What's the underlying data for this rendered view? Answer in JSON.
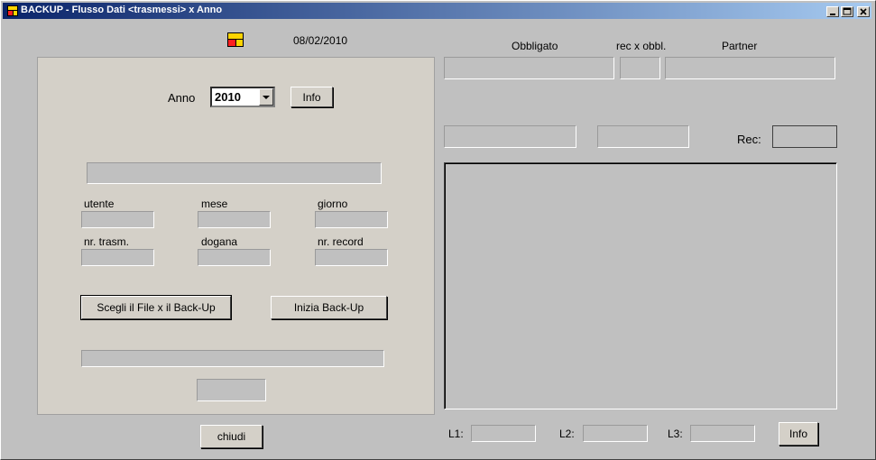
{
  "window": {
    "title": "BACKUP - Flusso Dati <trasmessi> x Anno",
    "controls": [
      "minimize-icon",
      "maximize-icon",
      "close-icon"
    ]
  },
  "header": {
    "date": "08/02/2010"
  },
  "left": {
    "anno_label": "Anno",
    "anno_value": "2010",
    "info_button": "Info",
    "labels": {
      "utente": "utente",
      "mese": "mese",
      "giorno": "giorno",
      "nr_trasm": "nr. trasm.",
      "dogana": "dogana",
      "nr_record": "nr. record"
    },
    "choose_file_button": "Scegli il File x il Back-Up",
    "start_button": "Inizia Back-Up"
  },
  "close_button": "chiudi",
  "right": {
    "col_obbligato": "Obbligato",
    "col_rec_obbl": "rec x obbl.",
    "col_partner": "Partner",
    "rec_label": "Rec:",
    "l1_label": "L1:",
    "l2_label": "L2:",
    "l3_label": "L3:",
    "info_button": "Info"
  }
}
